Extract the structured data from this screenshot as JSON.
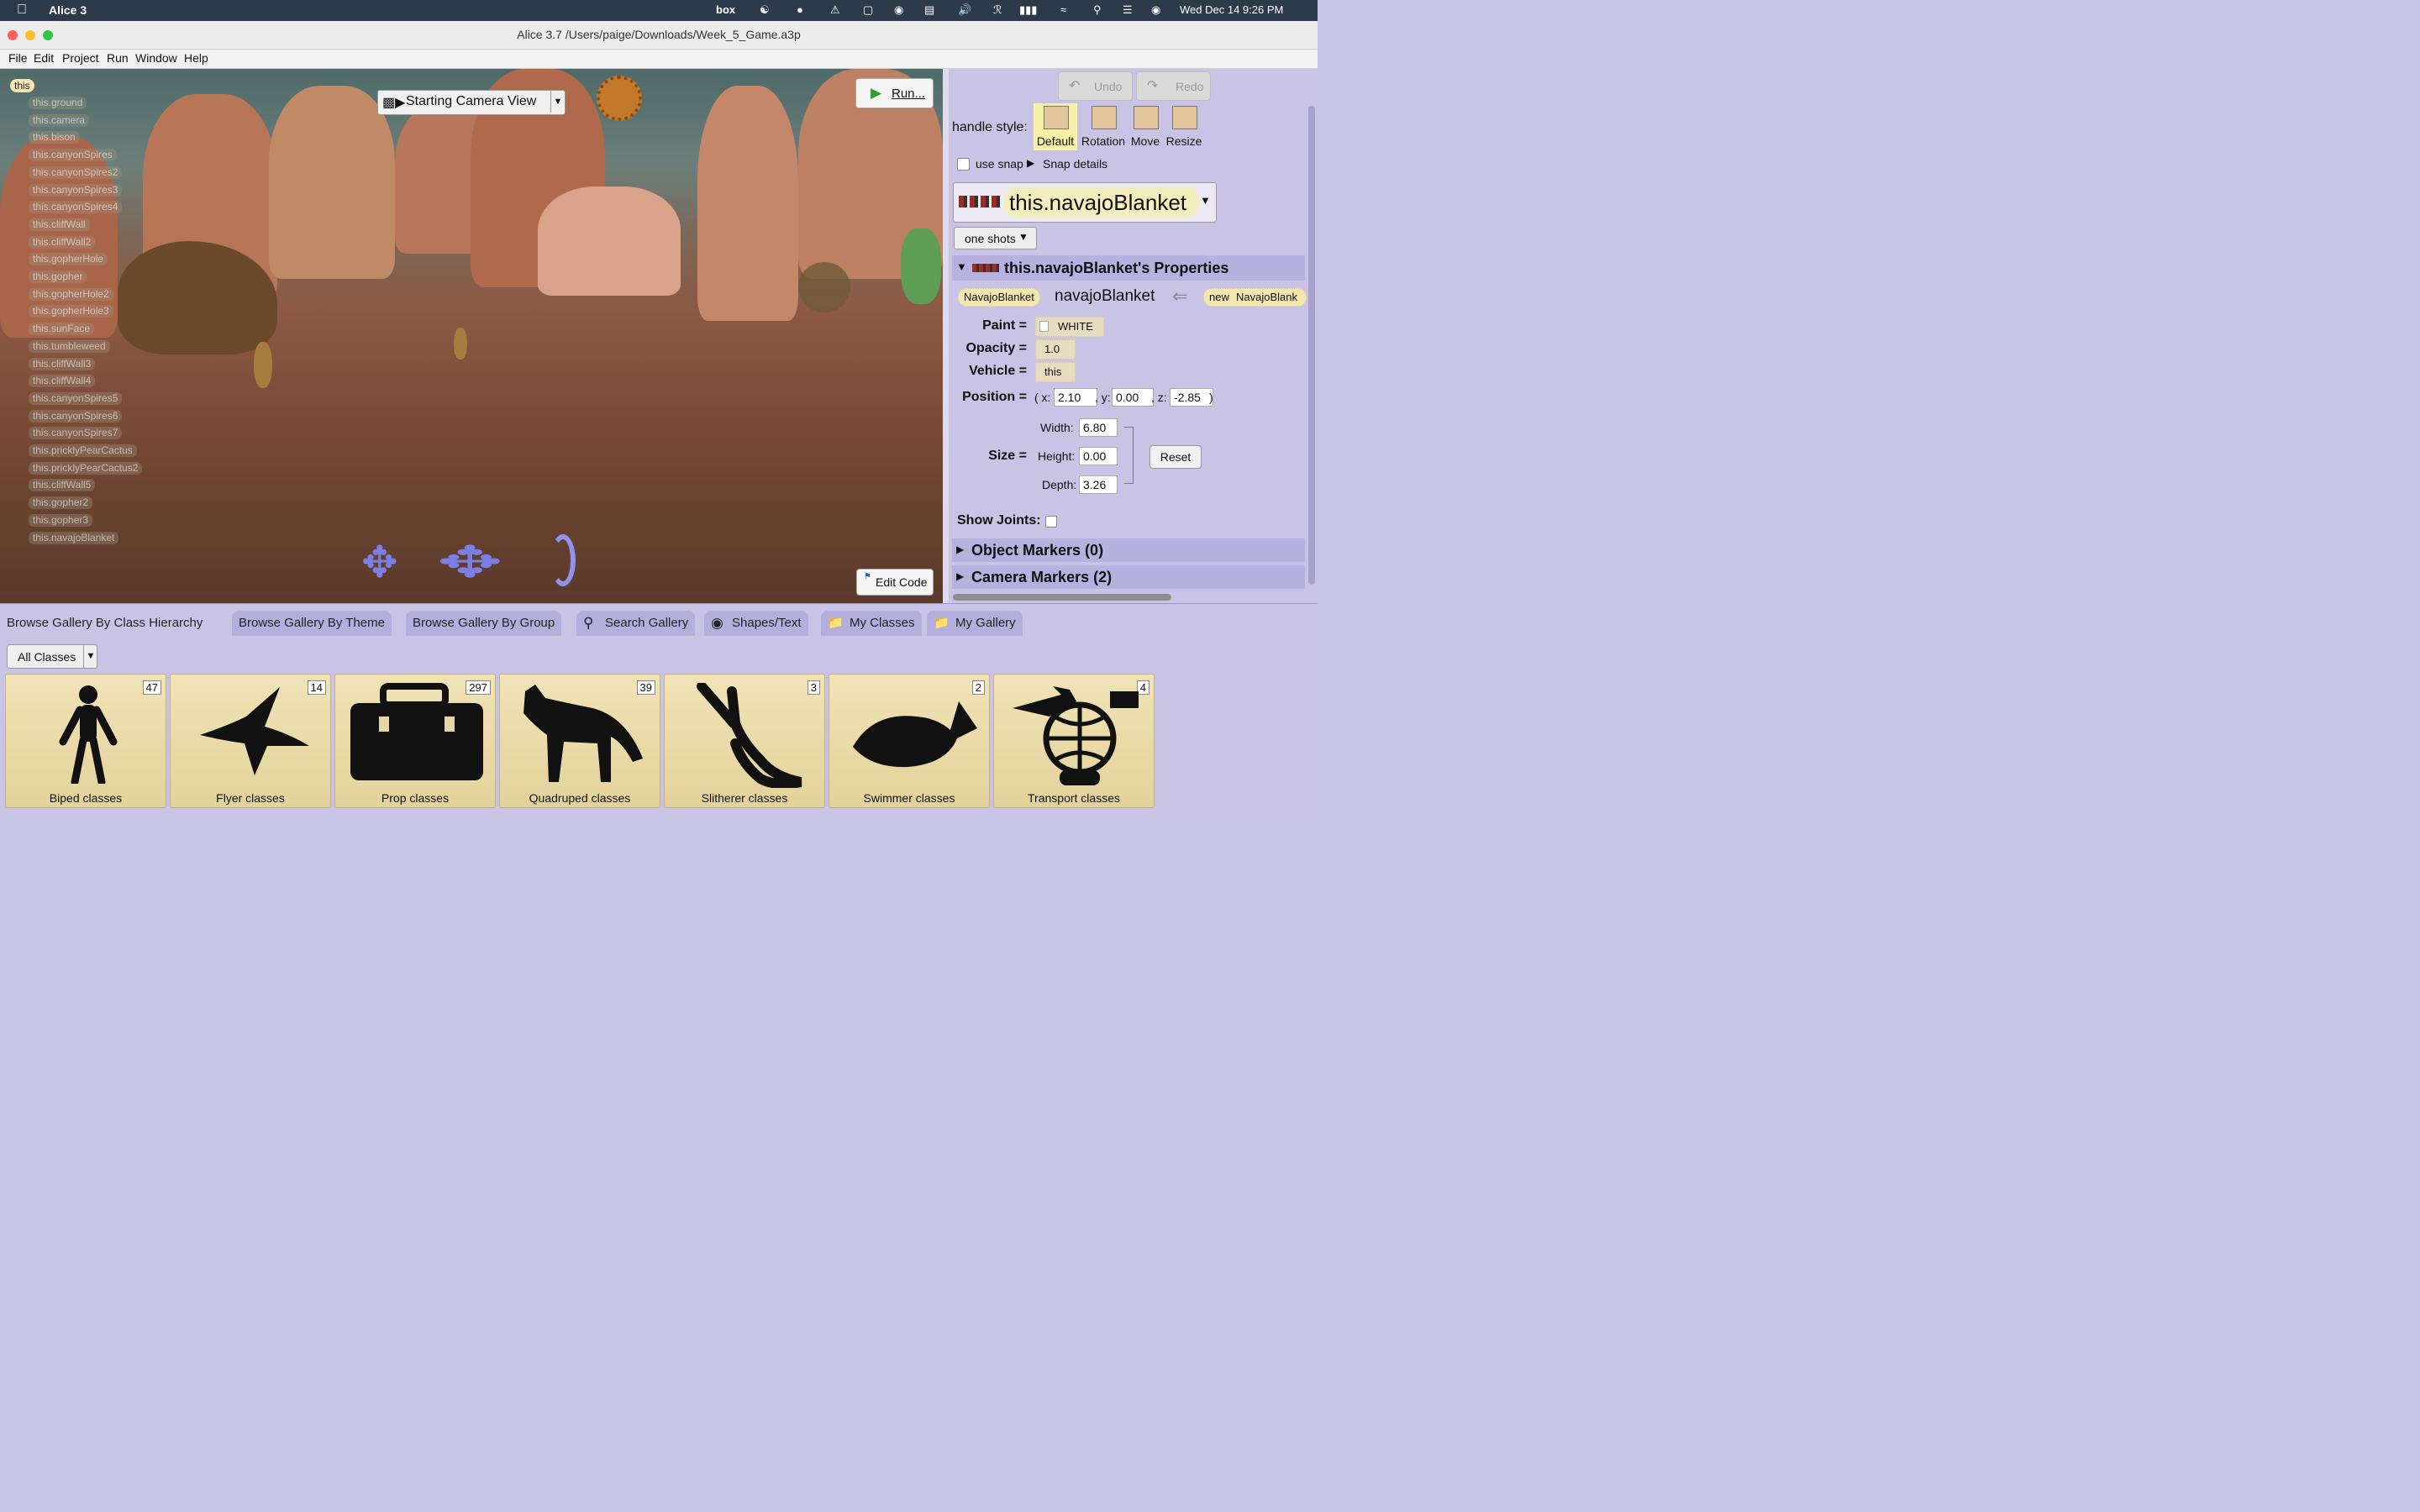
{
  "menubar": {
    "app_name": "Alice 3",
    "clock": "Wed Dec 14  9:26 PM",
    "box_label": "box"
  },
  "window": {
    "title": "Alice 3.7 /Users/paige/Downloads/Week_5_Game.a3p"
  },
  "app_menu": [
    "File",
    "Edit",
    "Project",
    "Run",
    "Window",
    "Help"
  ],
  "scene": {
    "root": "this",
    "objects": [
      "this.ground",
      "this.camera",
      "this.bison",
      "this.canyonSpires",
      "this.canyonSpires2",
      "this.canyonSpires3",
      "this.canyonSpires4",
      "this.cliffWall",
      "this.cliffWall2",
      "this.gopherHole",
      "this.gopher",
      "this.gopherHole2",
      "this.gopherHole3",
      "this.sunFace",
      "this.tumbleweed",
      "this.cliffWall3",
      "this.cliffWall4",
      "this.canyonSpires5",
      "this.canyonSpires6",
      "this.canyonSpires7",
      "this.pricklyPearCactus",
      "this.pricklyPearCactus2",
      "this.cliffWall5",
      "this.gopher2",
      "this.gopher3",
      "this.navajoBlanket"
    ],
    "camera_view": "Starting Camera View",
    "run_label": "Run...",
    "edit_code_label": "Edit Code"
  },
  "panel": {
    "undo": "Undo",
    "redo": "Redo",
    "handle_style_label": "handle style:",
    "handle_styles": [
      "Default",
      "Rotation",
      "Move",
      "Resize"
    ],
    "use_snap": "use snap",
    "snap_details": "Snap details",
    "selected": "this.navajoBlanket",
    "one_shots": "one shots",
    "properties_title": "this.navajoBlanket's Properties",
    "type_tag": "NavajoBlanket",
    "var_name": "navajoBlanket",
    "new_label": "new",
    "new_type": "NavajoBlank",
    "paint_label": "Paint =",
    "paint_value": "WHITE",
    "opacity_label": "Opacity =",
    "opacity_value": "1.0",
    "vehicle_label": "Vehicle =",
    "vehicle_value": "this",
    "position_label": "Position =",
    "pos_open": "( x:",
    "pos_x": "2.10",
    "pos_y_label": ", y:",
    "pos_y": "0.00",
    "pos_z_label": ", z:",
    "pos_z": "-2.85",
    "pos_close": ")",
    "size_label": "Size =",
    "width_label": "Width:",
    "width": "6.80",
    "height_label": "Height:",
    "height": "0.00",
    "depth_label": "Depth:",
    "depth": "3.26",
    "reset": "Reset",
    "show_joints": "Show Joints:",
    "object_markers": "Object Markers (0)",
    "camera_markers": "Camera Markers (2)"
  },
  "gallery": {
    "tabs": [
      "Browse Gallery By Class Hierarchy",
      "Browse Gallery By Theme",
      "Browse Gallery By Group",
      "Search Gallery",
      "Shapes/Text",
      "My Classes",
      "My Gallery"
    ],
    "filter": "All Classes",
    "cards": [
      {
        "label": "Biped classes",
        "count": "47",
        "icon": "biped-icon"
      },
      {
        "label": "Flyer classes",
        "count": "14",
        "icon": "flyer-icon"
      },
      {
        "label": "Prop classes",
        "count": "297",
        "icon": "prop-icon"
      },
      {
        "label": "Quadruped classes",
        "count": "39",
        "icon": "quadruped-icon"
      },
      {
        "label": "Slitherer classes",
        "count": "3",
        "icon": "slitherer-icon"
      },
      {
        "label": "Swimmer classes",
        "count": "2",
        "icon": "swimmer-icon"
      },
      {
        "label": "Transport classes",
        "count": "4",
        "icon": "transport-icon"
      }
    ]
  }
}
